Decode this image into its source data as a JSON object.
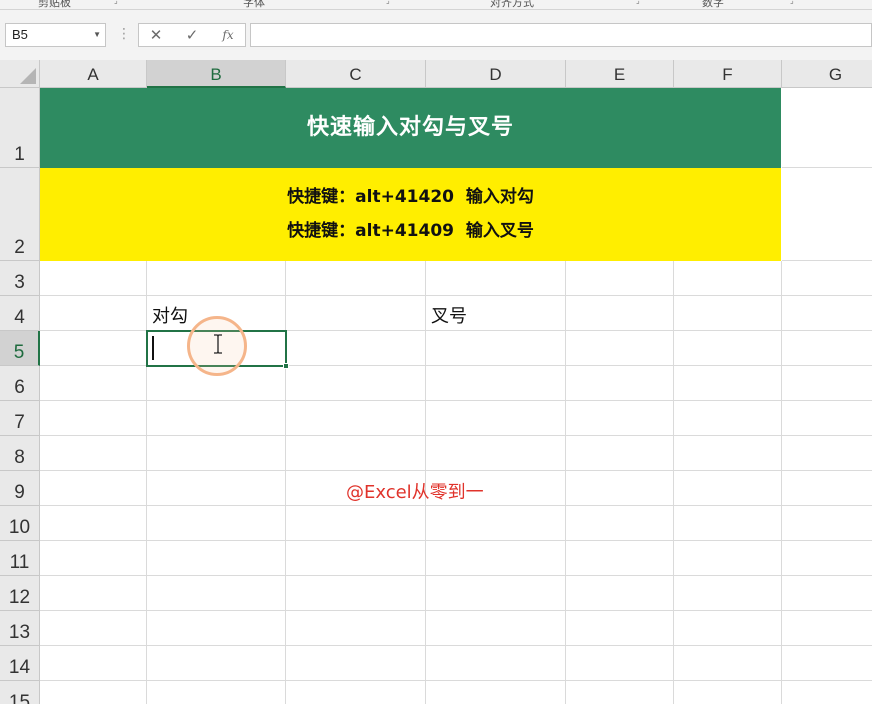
{
  "ribbon": {
    "groups": [
      "剪贴板",
      "字体",
      "对齐方式",
      "数字"
    ]
  },
  "formula_bar": {
    "name_box": "B5",
    "cancel_icon": "✕",
    "enter_icon": "✓",
    "fx_label": "fx",
    "formula_value": ""
  },
  "columns": [
    "A",
    "B",
    "C",
    "D",
    "E",
    "F",
    "G"
  ],
  "rows": [
    "1",
    "2",
    "3",
    "4",
    "5",
    "6",
    "7",
    "8",
    "9",
    "10",
    "11",
    "12",
    "13",
    "14",
    "15"
  ],
  "selected_cell": {
    "column": "B",
    "row": "5"
  },
  "sheet": {
    "title": "快速输入对勾与叉号",
    "shortcut_line1": "快捷键：alt+41420  输入对勾",
    "shortcut_line2": "快捷键：alt+41409  输入叉号",
    "b4": "对勾",
    "d4": "叉号",
    "watermark": "@Excel从零到一"
  },
  "colors": {
    "title_fill": "#2e8b61",
    "title_text": "#ffffff",
    "shortcut_fill": "#ffee00",
    "selection_border": "#217346",
    "watermark_text": "#e0332b",
    "click_ring": "#f5b58a"
  },
  "icons": [
    "name-box-dropdown-icon",
    "cancel-icon",
    "enter-icon",
    "insert-function-icon",
    "select-all-icon",
    "ibeam-cursor-icon"
  ]
}
